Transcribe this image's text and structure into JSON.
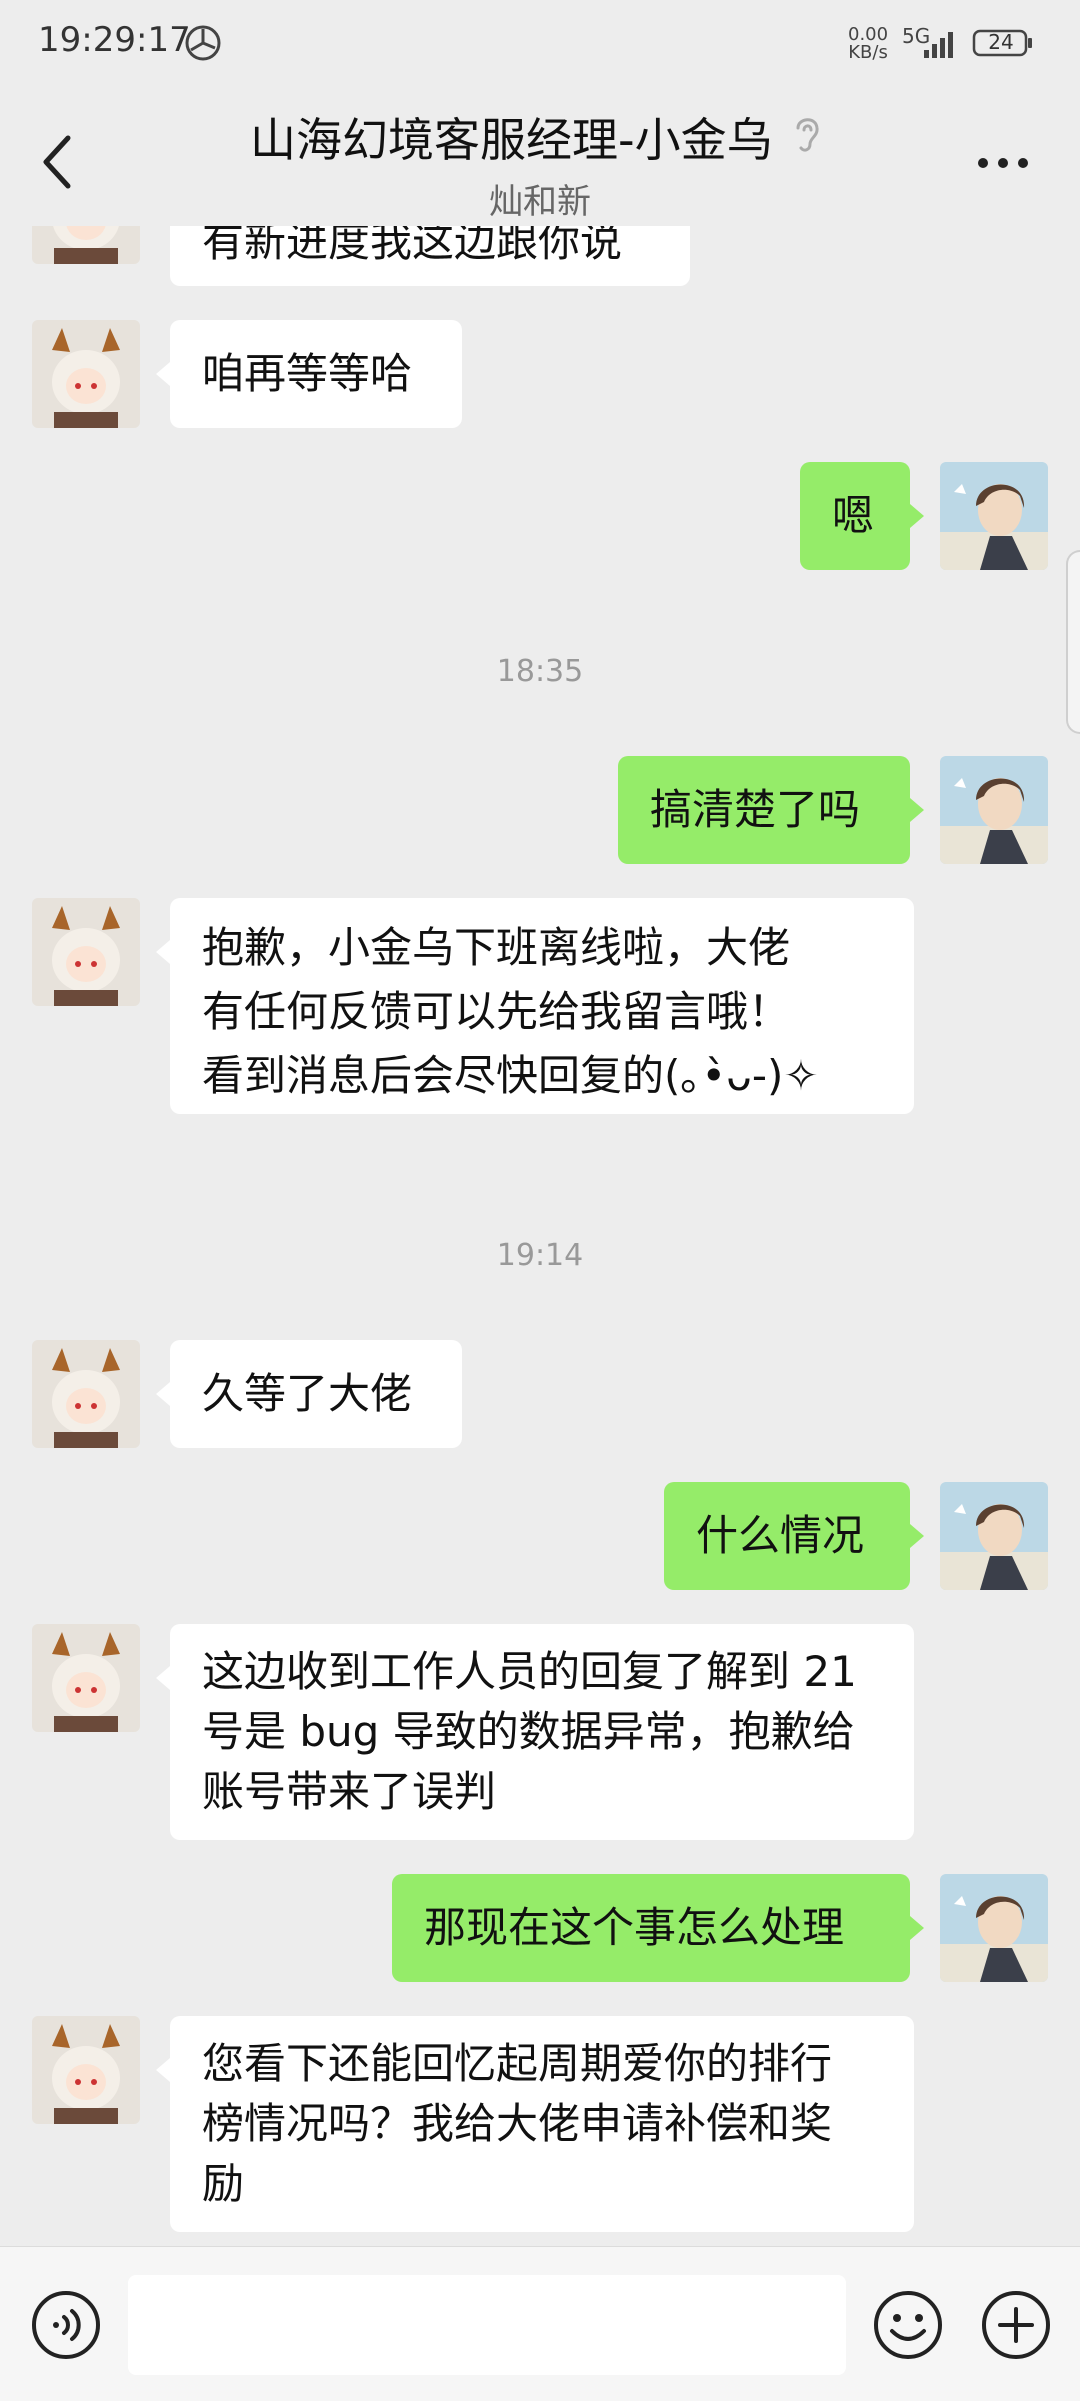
{
  "status_bar": {
    "time": "19:29:17",
    "net_speed_value": "0.00",
    "net_speed_unit": "KB/s",
    "network": "5G",
    "battery": "24"
  },
  "header": {
    "title": "山海幻境客服经理-小金乌",
    "subtitle": "灿和新",
    "icons": [
      "back-icon",
      "ear-icon",
      "more-icon"
    ]
  },
  "messages": [
    {
      "side": "left",
      "text": "有新进度我这边跟你说"
    },
    {
      "side": "left",
      "text": "咱再等等哈"
    },
    {
      "side": "right",
      "text": "嗯"
    },
    {
      "type": "time",
      "text": "18:35"
    },
    {
      "side": "right",
      "text": "搞清楚了吗"
    },
    {
      "side": "left",
      "lines": [
        "抱歉，小金乌下班离线啦，大佬",
        "有任何反馈可以先给我留言哦！",
        "看到消息后会尽快回复的(｡•̀ᴗ-)✧"
      ]
    },
    {
      "type": "time",
      "text": "19:14"
    },
    {
      "side": "left",
      "text": "久等了大佬"
    },
    {
      "side": "right",
      "text": "什么情况"
    },
    {
      "side": "left",
      "lines": [
        "这边收到工作人员的回复了解到 21",
        "号是 bug 导致的数据异常，抱歉给",
        "账号带来了误判"
      ]
    },
    {
      "side": "right",
      "text": "那现在这个事怎么处理"
    },
    {
      "side": "left",
      "lines": [
        "您看下还能回忆起周期爱你的排行",
        "榜情况吗？我给大佬申请补偿和奖",
        "励"
      ]
    }
  ],
  "input_bar": {
    "icons": [
      "voice-icon",
      "emoji-icon",
      "plus-icon"
    ],
    "placeholder": ""
  },
  "colors": {
    "background": "#ededed",
    "bubble_self": "#95ec69",
    "bubble_other": "#ffffff"
  }
}
